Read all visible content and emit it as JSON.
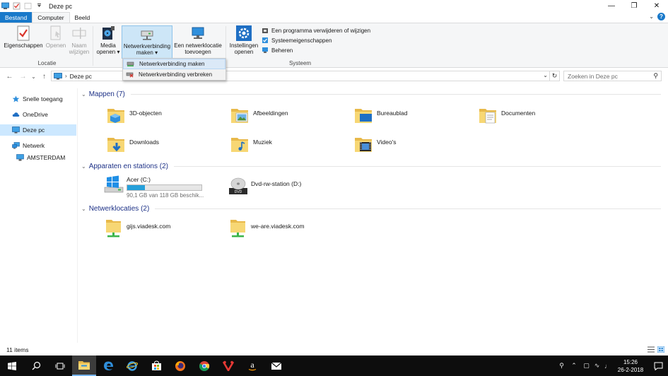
{
  "window": {
    "title": "Deze pc",
    "controls": [
      "minimize-icon",
      "restore-icon",
      "close-icon"
    ]
  },
  "tabs": [
    {
      "label": "Bestand",
      "active": false,
      "file": true
    },
    {
      "label": "Computer",
      "active": true,
      "file": false
    },
    {
      "label": "Beeld",
      "active": false,
      "file": false
    }
  ],
  "ribbon": {
    "groups": {
      "location": "Locatie",
      "system": "Systeem"
    },
    "buttons": {
      "properties": "Eigenschappen",
      "open": "Openen",
      "rename_1": "Naam",
      "rename_2": "wijzigen",
      "media_1": "Media",
      "media_2": "openen",
      "map_drive_1": "Netwerkverbinding",
      "map_drive_2": "maken",
      "add_location_1": "Een netwerklocatie",
      "add_location_2": "toevoegen",
      "settings_1": "Instellingen",
      "settings_2": "openen"
    },
    "system_items": [
      "Een programma verwijderen of wijzigen",
      "Systeemeigenschappen",
      "Beheren"
    ]
  },
  "dropdown": {
    "items": [
      "Netwerkverbinding maken",
      "Netwerkverbinding verbreken"
    ]
  },
  "address": {
    "path": "Deze pc",
    "search_placeholder": "Zoeken in Deze pc"
  },
  "nav_pane": {
    "items": [
      {
        "label": "Snelle toegang",
        "icon": "star-icon",
        "selected": false
      },
      {
        "label": "OneDrive",
        "icon": "cloud-icon",
        "selected": false
      },
      {
        "label": "Deze pc",
        "icon": "monitor-icon",
        "selected": true
      },
      {
        "label": "Netwerk",
        "icon": "network-icon",
        "selected": false
      },
      {
        "label": "AMSTERDAM",
        "icon": "computer-icon",
        "selected": false
      }
    ]
  },
  "sections": {
    "folders": {
      "title": "Mappen (7)",
      "items": [
        "3D-objecten",
        "Afbeeldingen",
        "Bureaublad",
        "Documenten",
        "Downloads",
        "Muziek",
        "Video's"
      ]
    },
    "devices": {
      "title": "Apparaten en stations (2)",
      "drives": [
        {
          "name": "Acer (C:)",
          "sub": "90,1 GB van 118 GB beschik...",
          "used_fraction": 0.24
        },
        {
          "name": "Dvd-rw-station (D:)",
          "sub": ""
        }
      ]
    },
    "network": {
      "title": "Netwerklocaties (2)",
      "items": [
        "gijs.viadesk.com",
        "we-are.viadesk.com"
      ]
    }
  },
  "status": {
    "count": "11 items"
  },
  "taskbar": {
    "apps": [
      "start-icon",
      "search-icon",
      "task-view-icon",
      "file-explorer-icon",
      "edge-icon",
      "internet-explorer-icon",
      "store-icon",
      "firefox-icon",
      "chrome-icon",
      "vivaldi-icon",
      "amazon-icon",
      "mail-icon"
    ],
    "time": "15:26",
    "date": "26-2-2018"
  },
  "colors": {
    "accent": "#1979ca",
    "selected_bg": "#cce8ff",
    "section_title": "#1e3287",
    "drive_fill": "#26a0da",
    "taskbar_bg": "#0d0d0d"
  }
}
